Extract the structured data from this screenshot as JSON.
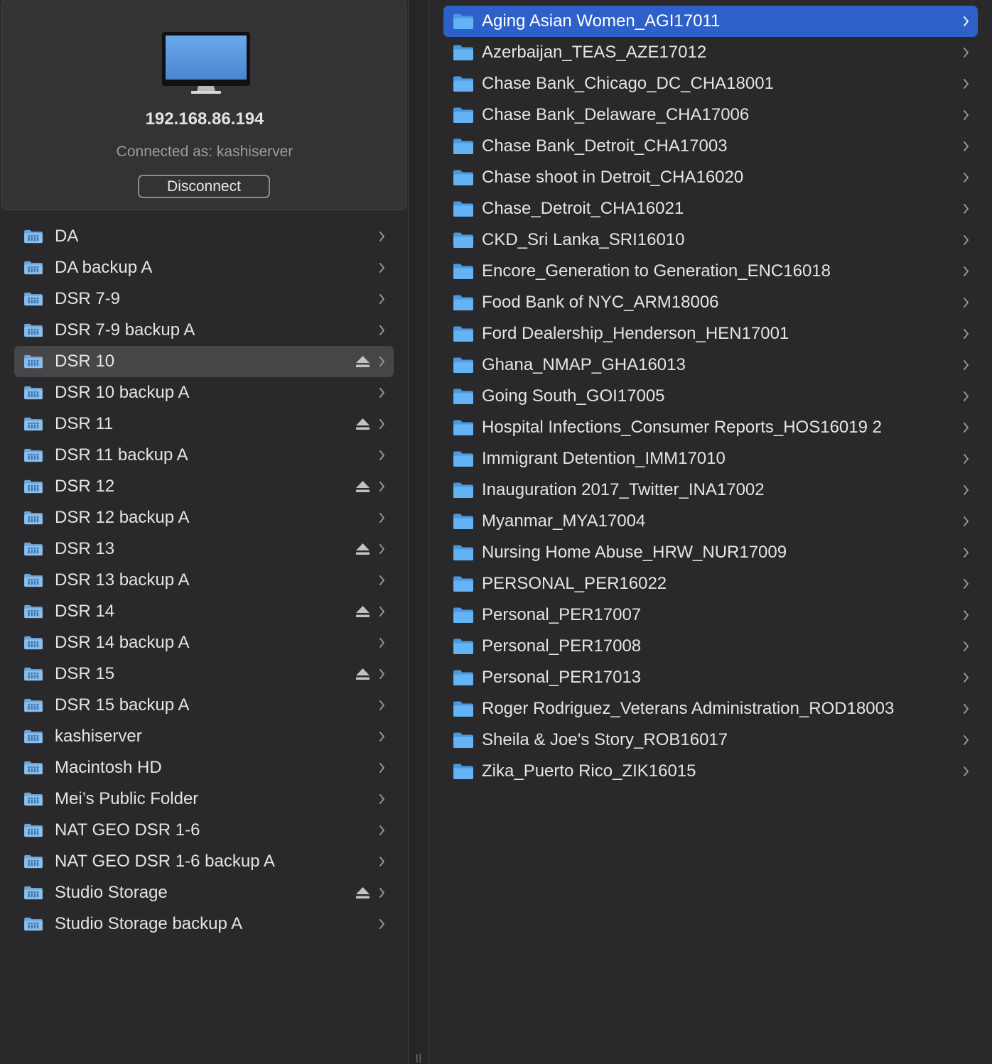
{
  "server": {
    "ip": "192.168.86.194",
    "connected_as": "Connected as: kashiserver",
    "disconnect_label": "Disconnect",
    "icon": "imac-monitor-icon"
  },
  "colors": {
    "background": "#29292b",
    "card": "#333335",
    "left_selected": "#464649",
    "right_selected": "#2e60c9",
    "folder_blue": "#5aaef2"
  },
  "shares": [
    {
      "label": "DA",
      "eject": false,
      "selected": false
    },
    {
      "label": "DA backup A",
      "eject": false,
      "selected": false
    },
    {
      "label": "DSR 7-9",
      "eject": false,
      "selected": false
    },
    {
      "label": "DSR 7-9 backup A",
      "eject": false,
      "selected": false
    },
    {
      "label": "DSR 10",
      "eject": true,
      "selected": true
    },
    {
      "label": "DSR 10 backup A",
      "eject": false,
      "selected": false
    },
    {
      "label": "DSR 11",
      "eject": true,
      "selected": false
    },
    {
      "label": "DSR 11 backup A",
      "eject": false,
      "selected": false
    },
    {
      "label": "DSR 12",
      "eject": true,
      "selected": false
    },
    {
      "label": "DSR 12 backup A",
      "eject": false,
      "selected": false
    },
    {
      "label": "DSR 13",
      "eject": true,
      "selected": false
    },
    {
      "label": "DSR 13 backup A",
      "eject": false,
      "selected": false
    },
    {
      "label": "DSR 14",
      "eject": true,
      "selected": false
    },
    {
      "label": "DSR 14 backup A",
      "eject": false,
      "selected": false
    },
    {
      "label": "DSR 15",
      "eject": true,
      "selected": false
    },
    {
      "label": "DSR 15 backup A",
      "eject": false,
      "selected": false
    },
    {
      "label": "kashiserver",
      "eject": false,
      "selected": false
    },
    {
      "label": "Macintosh HD",
      "eject": false,
      "selected": false
    },
    {
      "label": "Mei’s Public Folder",
      "eject": false,
      "selected": false
    },
    {
      "label": "NAT GEO DSR 1-6",
      "eject": false,
      "selected": false
    },
    {
      "label": "NAT GEO DSR 1-6 backup A",
      "eject": false,
      "selected": false
    },
    {
      "label": "Studio Storage",
      "eject": true,
      "selected": false
    },
    {
      "label": "Studio Storage backup A",
      "eject": false,
      "selected": false
    }
  ],
  "folders": [
    {
      "label": "Aging Asian Women_AGI17011",
      "selected": true
    },
    {
      "label": "Azerbaijan_TEAS_AZE17012",
      "selected": false
    },
    {
      "label": "Chase Bank_Chicago_DC_CHA18001",
      "selected": false
    },
    {
      "label": "Chase Bank_Delaware_CHA17006",
      "selected": false
    },
    {
      "label": "Chase Bank_Detroit_CHA17003",
      "selected": false
    },
    {
      "label": "Chase shoot in Detroit_CHA16020",
      "selected": false
    },
    {
      "label": "Chase_Detroit_CHA16021",
      "selected": false
    },
    {
      "label": "CKD_Sri Lanka_SRI16010",
      "selected": false
    },
    {
      "label": "Encore_Generation to Generation_ENC16018",
      "selected": false
    },
    {
      "label": "Food Bank of NYC_ARM18006",
      "selected": false
    },
    {
      "label": "Ford Dealership_Henderson_HEN17001",
      "selected": false
    },
    {
      "label": "Ghana_NMAP_GHA16013",
      "selected": false
    },
    {
      "label": "Going South_GOI17005",
      "selected": false
    },
    {
      "label": "Hospital Infections_Consumer Reports_HOS16019 2",
      "selected": false
    },
    {
      "label": "Immigrant Detention_IMM17010",
      "selected": false
    },
    {
      "label": "Inauguration 2017_Twitter_INA17002",
      "selected": false
    },
    {
      "label": "Myanmar_MYA17004",
      "selected": false
    },
    {
      "label": "Nursing Home Abuse_HRW_NUR17009",
      "selected": false
    },
    {
      "label": "PERSONAL_PER16022",
      "selected": false
    },
    {
      "label": "Personal_PER17007",
      "selected": false
    },
    {
      "label": "Personal_PER17008",
      "selected": false
    },
    {
      "label": "Personal_PER17013",
      "selected": false
    },
    {
      "label": "Roger Rodriguez_Veterans Administration_ROD18003",
      "selected": false
    },
    {
      "label": "Sheila & Joe's Story_ROB16017",
      "selected": false
    },
    {
      "label": "Zika_Puerto Rico_ZIK16015",
      "selected": false
    }
  ]
}
